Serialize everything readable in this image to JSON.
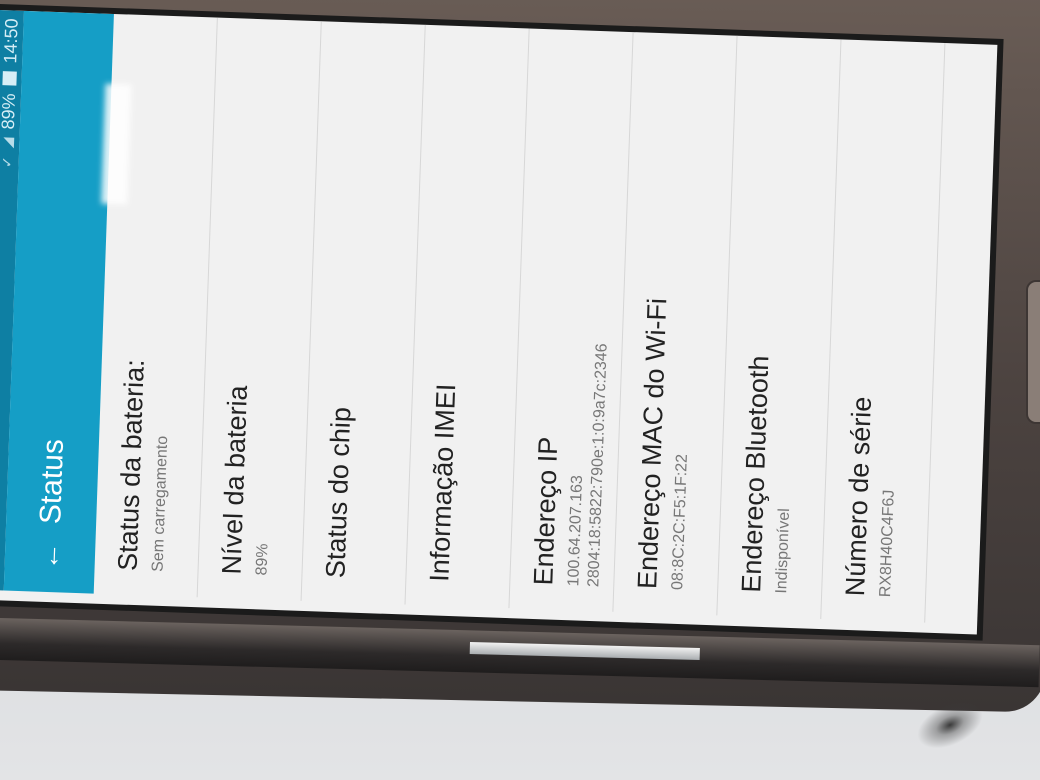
{
  "status_bar": {
    "battery_percent": "89%",
    "time": "14:50"
  },
  "header": {
    "title": "Status"
  },
  "items": [
    {
      "title": "Status da bateria:",
      "sub": "Sem carregamento",
      "sub2": ""
    },
    {
      "title": "Nível da bateria",
      "sub": "89%",
      "sub2": ""
    },
    {
      "title": "Status do chip",
      "sub": "",
      "sub2": ""
    },
    {
      "title": "Informação IMEI",
      "sub": "",
      "sub2": ""
    },
    {
      "title": "Endereço IP",
      "sub": "100.64.207.163",
      "sub2": "2804:18:5822:790e:1:0:9a7c:2346"
    },
    {
      "title": "Endereço MAC do Wi-Fi",
      "sub": "08:8C:2C:F5:1F:22",
      "sub2": ""
    },
    {
      "title": "Endereço Bluetooth",
      "sub": "Indisponível",
      "sub2": ""
    },
    {
      "title": "Número de série",
      "sub": "RX8H40C4F6J",
      "sub2": ""
    }
  ],
  "colors": {
    "action_bar": "#159ec6",
    "status_bar": "#0e7fa3"
  }
}
